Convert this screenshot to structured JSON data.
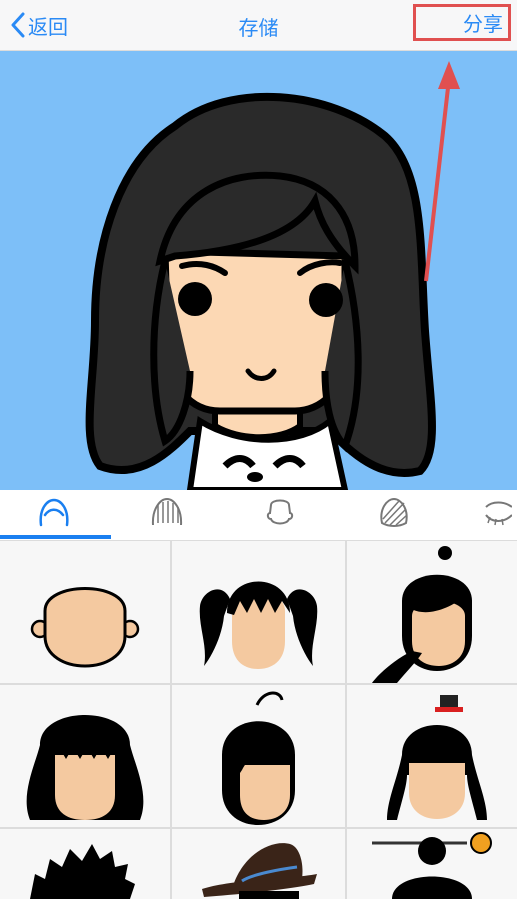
{
  "navbar": {
    "back_label": "返回",
    "title": "存储",
    "share_label": "分享",
    "accent_color": "#2a8af5",
    "highlight_color": "#e05050"
  },
  "preview": {
    "background_color": "#7dbff8"
  },
  "tabs": {
    "selected_index": 0,
    "items": [
      {
        "icon": "hair-icon"
      },
      {
        "icon": "hair-texture-icon"
      },
      {
        "icon": "face-shape-icon"
      },
      {
        "icon": "hair-pattern-icon"
      },
      {
        "icon": "eyelash-icon"
      }
    ]
  },
  "options": {
    "items": [
      {
        "style": "bald"
      },
      {
        "style": "twin-ponytails"
      },
      {
        "style": "side-ponytail"
      },
      {
        "style": "long-wavy-bangs"
      },
      {
        "style": "side-swept-antenna"
      },
      {
        "style": "braids-with-tiny-hat"
      },
      {
        "style": "spiky-short"
      },
      {
        "style": "bowler-hat"
      },
      {
        "style": "bun-with-hairpin"
      }
    ]
  }
}
